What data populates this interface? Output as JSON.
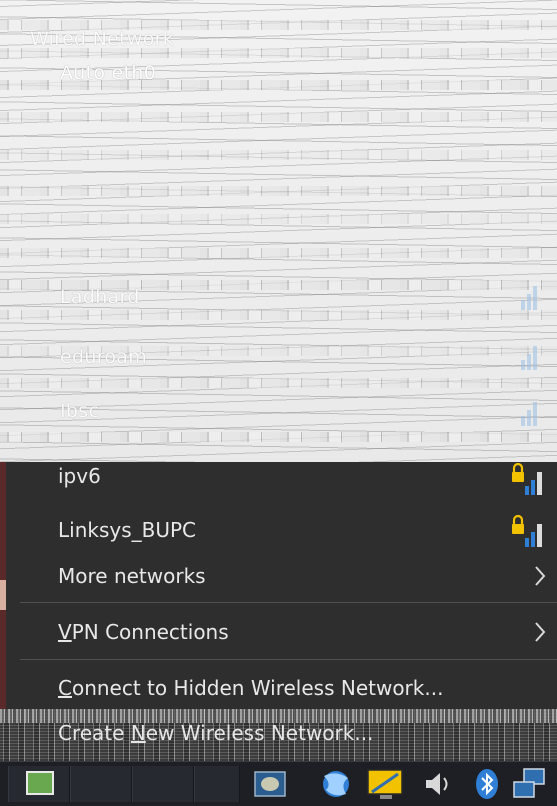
{
  "glitch_area": {
    "rows": [
      "Wired Network",
      "Auto eth0",
      "Ladhard",
      "eduroam",
      "Ibsc"
    ]
  },
  "menu": {
    "network_items": [
      {
        "label": "ipv6",
        "secured": true,
        "signal": "full"
      },
      {
        "label": "Linksys_BUPC",
        "secured": true,
        "signal": "full"
      }
    ],
    "more_networks": {
      "label": "More networks",
      "icon": "chevron-right-icon"
    },
    "vpn": {
      "label_prefix": "",
      "mnemonic": "V",
      "label_rest": "PN Connections",
      "icon": "chevron-right-icon"
    },
    "connect_hidden": {
      "mnemonic": "C",
      "label_rest": "onnect to Hidden Wireless Network..."
    },
    "create_new": {
      "prefix": "Create ",
      "mnemonic": "N",
      "label_rest": "ew Wireless Network..."
    }
  },
  "taskbar": {
    "icons": [
      "desktop-switcher-icon",
      "show-desktop-icon",
      "network-manager-icon",
      "display-icon",
      "volume-icon",
      "bluetooth-icon",
      "network-connections-icon"
    ]
  },
  "colors": {
    "menu_bg": "#2e2e2e",
    "text": "#e8e8e8",
    "signal_bars": "#2f7fd6",
    "lock": "#f2c200",
    "taskbar_bg": "#1d1f24"
  }
}
